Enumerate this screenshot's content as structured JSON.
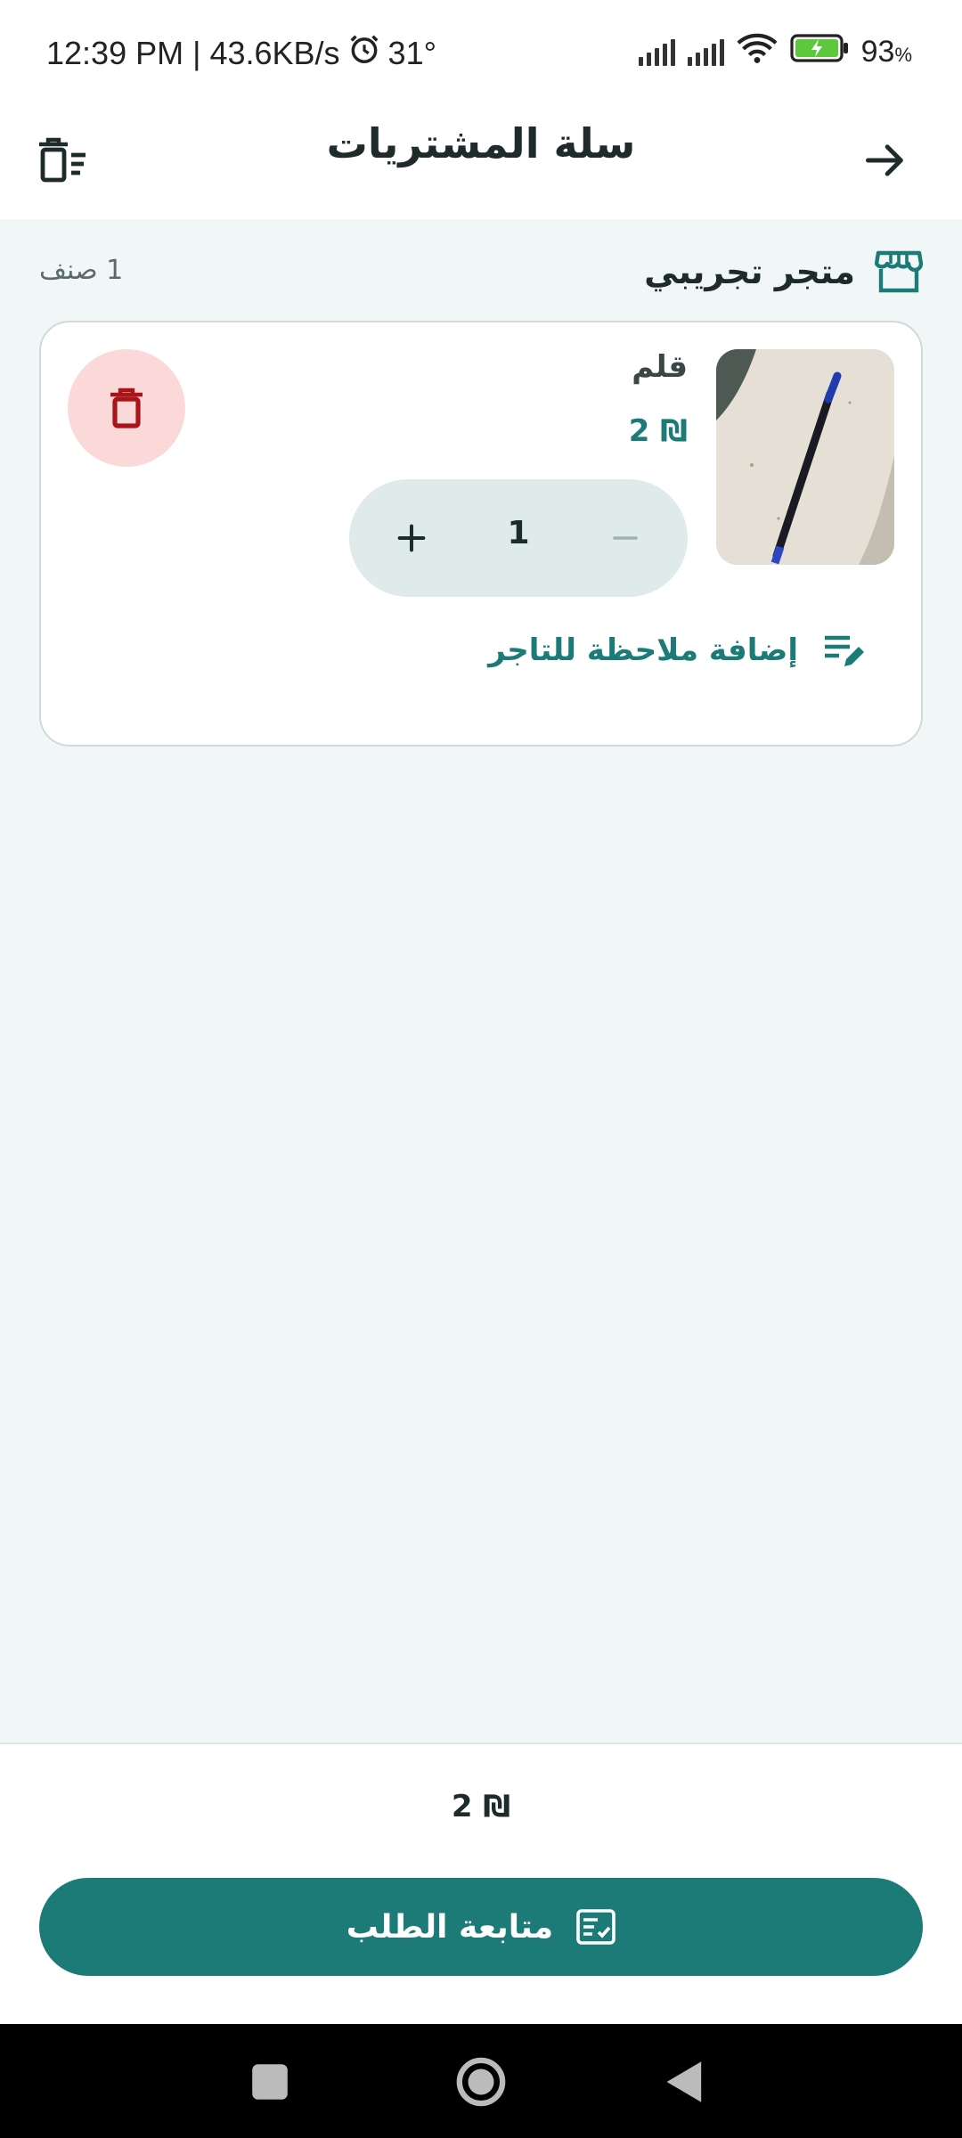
{
  "status_bar": {
    "time_info": "12:39 PM | 43.6KB/s",
    "temperature": "31°",
    "battery": "93",
    "battery_unit": "%"
  },
  "header": {
    "title": "سلة المشتريات"
  },
  "store": {
    "name": "متجر تجريبي",
    "item_count": "1 صنف"
  },
  "cart_item": {
    "name": "قلم",
    "price": "₪ 2",
    "quantity": "1",
    "add_note_label": "إضافة ملاحظة للتاجر"
  },
  "footer": {
    "total": "₪ 2",
    "checkout_label": "متابعة الطلب"
  },
  "colors": {
    "accent": "#1c7a77",
    "delete_bg": "#fbd9d9",
    "delete_icon": "#a8141a",
    "content_bg": "#f1f7f7"
  },
  "icons": {
    "back": "arrow-right-icon",
    "clear_cart": "trash-list-icon",
    "store": "store-icon",
    "delete": "trash-icon",
    "note": "edit-note-icon",
    "checkout": "checklist-icon"
  }
}
